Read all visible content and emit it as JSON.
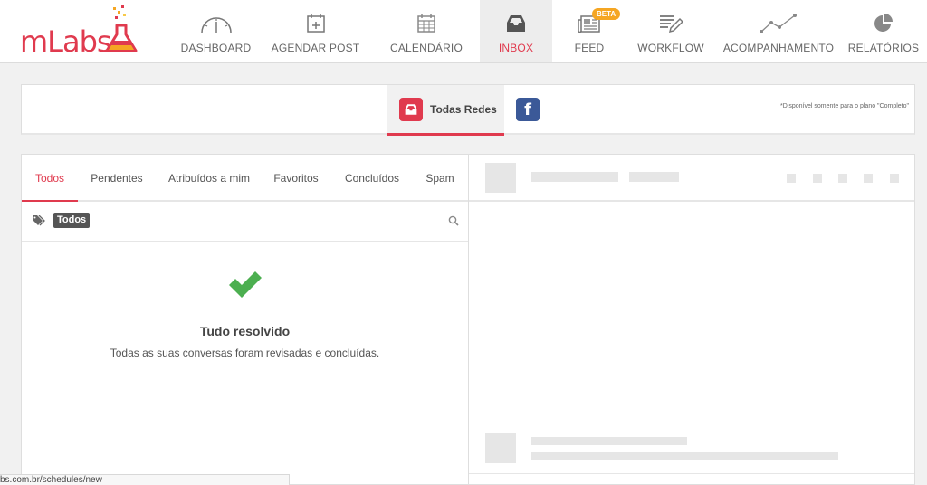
{
  "brand": {
    "name": "mLabs",
    "color": "#e03a4e"
  },
  "nav": [
    {
      "label": "DASHBOARD",
      "icon": "gauge-icon"
    },
    {
      "label": "AGENDAR POST",
      "icon": "calendar-plus-icon"
    },
    {
      "label": "CALENDÁRIO",
      "icon": "calendar-icon"
    },
    {
      "label": "INBOX",
      "icon": "inbox-icon",
      "active": true
    },
    {
      "label": "FEED",
      "icon": "news-icon",
      "badge": "BETA"
    },
    {
      "label": "WORKFLOW",
      "icon": "edit-list-icon"
    },
    {
      "label": "ACOMPANHAMENTO",
      "icon": "line-chart-icon"
    },
    {
      "label": "RELATÓRIOS",
      "icon": "pie-chart-icon"
    }
  ],
  "networks": {
    "all_label": "Todas Redes",
    "facebook_letter": "f",
    "note": "*Disponível somente para o plano \"Completo\""
  },
  "inbox": {
    "tabs": [
      "Todos",
      "Pendentes",
      "Atribuídos a mim",
      "Favoritos",
      "Concluídos",
      "Spam"
    ],
    "filter_chip": "Todos",
    "empty_title": "Tudo resolvido",
    "empty_subtitle": "Todas as suas conversas foram revisadas e concluídas."
  },
  "status_url": "bs.com.br/schedules/new"
}
